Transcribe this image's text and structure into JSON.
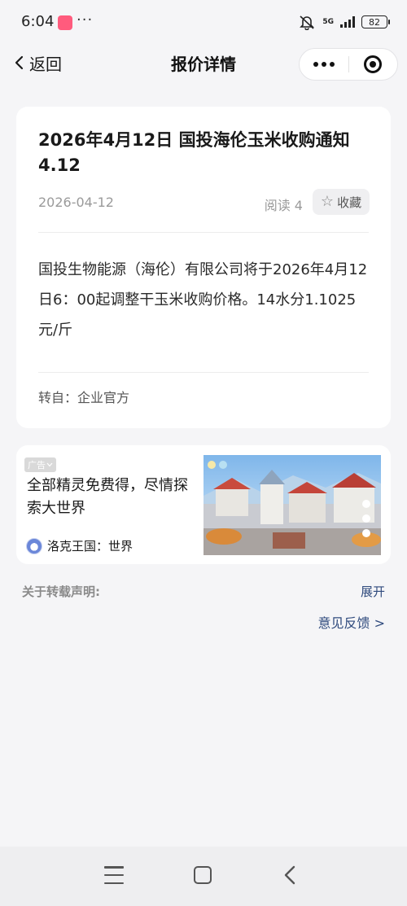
{
  "status_bar": {
    "time": "6:04",
    "dots": "···",
    "network": "5G",
    "battery": "82"
  },
  "nav": {
    "back_label": "返回",
    "title": "报价详情"
  },
  "article": {
    "title": "2026年4月12日 国投海伦玉米收购通知4.12",
    "date": "2026-04-12",
    "read_label": "阅读 4",
    "favorite_label": "收藏",
    "body": "国投生物能源（海伦）有限公司将于2026年4月12日6：00起调整干玉米收购价格。14水分1.1025元/斤",
    "source": "转自：企业官方"
  },
  "ad": {
    "badge": "广告",
    "headline": "全部精灵免费得，尽情探索大世界",
    "brand": "洛克王国：世界"
  },
  "footer": {
    "disclaimer_label": "关于转载声明:",
    "expand_label": "展开",
    "feedback_label": "意见反馈 >"
  },
  "icons": {
    "back": "chevron-left-icon",
    "more": "more-dots-icon",
    "close": "target-close-icon",
    "favorite": "star-outline-icon",
    "menu": "menu-icon",
    "home": "home-square-icon",
    "sys_back": "chevron-left-icon"
  },
  "colors": {
    "background": "#f5f5f7",
    "card": "#ffffff",
    "link": "#2f4a7d",
    "muted_text": "#9a9a9a"
  }
}
